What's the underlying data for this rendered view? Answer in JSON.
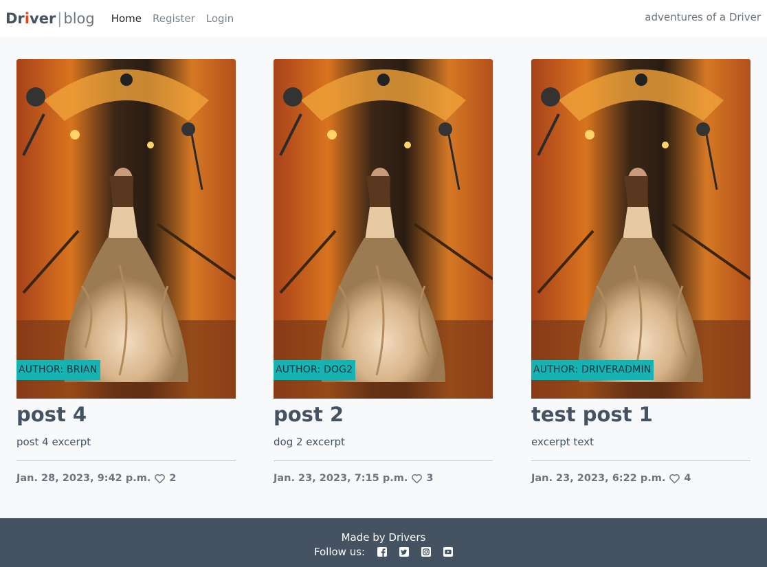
{
  "nav": {
    "brand_strong_a": "Dr",
    "brand_strong_i": "i",
    "brand_strong_b": "ver",
    "brand_sep": "|",
    "brand_light": "blog",
    "links": [
      {
        "label": "Home"
      },
      {
        "label": "Register"
      },
      {
        "label": "Login"
      }
    ],
    "tagline": "adventures of a Driver"
  },
  "posts": [
    {
      "author": "Author: Brian",
      "title": "post 4",
      "excerpt": "post 4 excerpt",
      "date": "Jan. 28, 2023, 9:42 p.m.",
      "likes": "2"
    },
    {
      "author": "Author: dog2",
      "title": "post 2",
      "excerpt": "dog 2 excerpt",
      "date": "Jan. 23, 2023, 7:15 p.m.",
      "likes": "3"
    },
    {
      "author": "Author: driveradmin",
      "title": "test post 1",
      "excerpt": "excerpt text",
      "date": "Jan. 23, 2023, 6:22 p.m.",
      "likes": "4"
    }
  ],
  "footer": {
    "made_by": "Made by Drivers",
    "follow": "Follow us:",
    "social_icons": [
      "facebook-icon",
      "twitter-icon",
      "instagram-icon",
      "youtube-icon"
    ]
  },
  "colors": {
    "accent_teal": "#17b3b3",
    "footer_bg": "#445261",
    "brand_red": "#e84610"
  }
}
